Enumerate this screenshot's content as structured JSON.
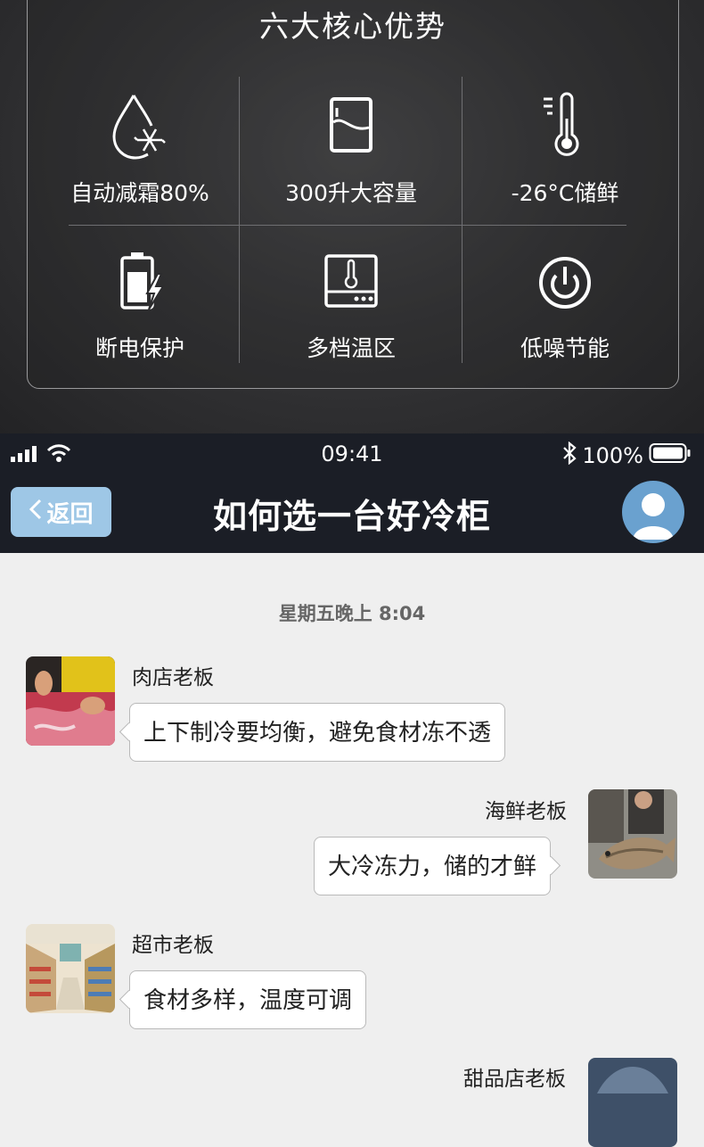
{
  "features": {
    "title": "六大核心优势",
    "items": [
      {
        "label": "自动减霜80%",
        "icon": "drop-snowflake-icon"
      },
      {
        "label": "300升大容量",
        "icon": "fridge-icon"
      },
      {
        "label": "-26°C储鲜",
        "icon": "thermometer-icon"
      },
      {
        "label": "断电保护",
        "icon": "battery-charge-icon"
      },
      {
        "label": "多档温区",
        "icon": "thermostat-panel-icon"
      },
      {
        "label": "低噪节能",
        "icon": "power-icon"
      }
    ]
  },
  "status_bar": {
    "time": "09:41",
    "battery": "100%"
  },
  "nav": {
    "back_label": "返回",
    "title": "如何选一台好冷柜"
  },
  "chat": {
    "timestamp": "星期五晚上 8:04",
    "messages": [
      {
        "side": "left",
        "name": "肉店老板",
        "text": "上下制冷要均衡，避免食材冻不透",
        "avatar": "butcher-avatar"
      },
      {
        "side": "right",
        "name": "海鲜老板",
        "text": "大冷冻力，储的才鲜",
        "avatar": "fishmonger-avatar"
      },
      {
        "side": "left",
        "name": "超市老板",
        "text": "食材多样，温度可调",
        "avatar": "supermarket-avatar"
      },
      {
        "side": "right",
        "name": "甜品店老板",
        "text": "",
        "avatar": "dessert-shop-avatar"
      }
    ]
  },
  "colors": {
    "header_bg": "#1b1e26",
    "back_button": "#9ec7e6",
    "chat_bg": "#efefef",
    "panel_bg": "#353537"
  }
}
